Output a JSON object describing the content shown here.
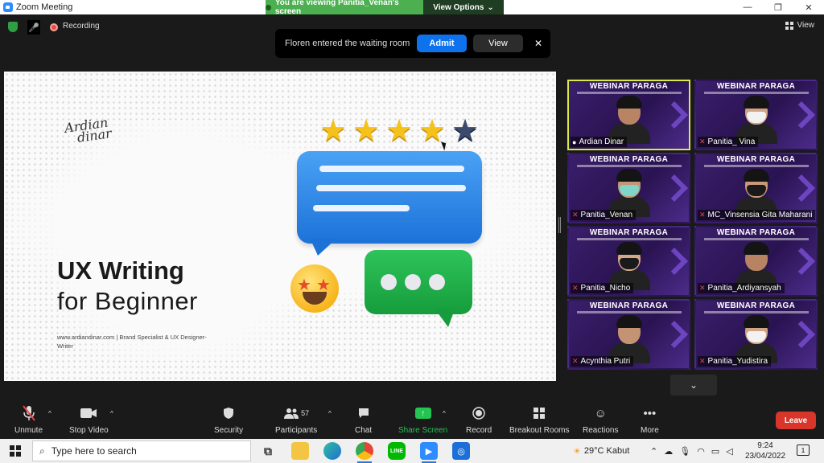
{
  "titlebar": {
    "title": "Zoom Meeting",
    "viewing_banner": "You are viewing Panitia_Venan's screen",
    "view_options": "View Options",
    "minimize": "—",
    "restore": "❐",
    "close": "✕"
  },
  "status_row": {
    "recording": "Recording",
    "view": "View"
  },
  "waiting_notification": {
    "message": "Floren entered the waiting room",
    "admit": "Admit",
    "view": "View",
    "close": "✕"
  },
  "slide": {
    "signature_line1": "Ardian",
    "signature_line2": "dinar",
    "title": "UX Writing",
    "subtitle": "for Beginner",
    "footer": "www.ardiandinar.com | Brand Specialist & UX Designer-Writer",
    "rating": {
      "filled": 4,
      "total": 5
    }
  },
  "gallery": {
    "banner": "WEBINAR PARAGA",
    "tiles": [
      {
        "name": "Ardian Dinar",
        "muted": false,
        "active": true,
        "mask": false,
        "skin": "#b98463"
      },
      {
        "name": "Panitia_ Vina",
        "muted": true,
        "active": false,
        "mask": true,
        "skin": "#d2a487"
      },
      {
        "name": "Panitia_Venan",
        "muted": true,
        "active": false,
        "mask": true,
        "skin": "#c59677"
      },
      {
        "name": "MC_Vinsensia Gita Maharani",
        "muted": true,
        "active": false,
        "mask": true,
        "skin": "#c99a7a"
      },
      {
        "name": "Panitia_Nicho",
        "muted": true,
        "active": false,
        "mask": true,
        "skin": "#d4a98a"
      },
      {
        "name": "Panitia_Ardiyansyah",
        "muted": true,
        "active": false,
        "mask": false,
        "skin": "#b88363"
      },
      {
        "name": "Acynthia Putri",
        "muted": true,
        "active": false,
        "mask": false,
        "skin": "#c49373"
      },
      {
        "name": "Panitia_Yudistira",
        "muted": true,
        "active": false,
        "mask": true,
        "skin": "#d0a585"
      }
    ],
    "scroll_down": "⌄"
  },
  "toolbar": {
    "unmute": "Unmute",
    "stop_video": "Stop Video",
    "security": "Security",
    "participants": "Participants",
    "participant_count": "57",
    "chat": "Chat",
    "share_screen": "Share Screen",
    "record": "Record",
    "breakout_rooms": "Breakout Rooms",
    "reactions": "Reactions",
    "more": "More",
    "leave": "Leave"
  },
  "taskbar": {
    "search_placeholder": "Type here to search",
    "weather": "29°C  Kabut",
    "time": "9:24",
    "date": "23/04/2022",
    "notification_count": "1"
  },
  "colors": {
    "accent": "#0e72ed",
    "share_green": "#23c552",
    "leave_red": "#d9362b",
    "star": "#f5c21b",
    "active_border": "#d9e84a"
  }
}
